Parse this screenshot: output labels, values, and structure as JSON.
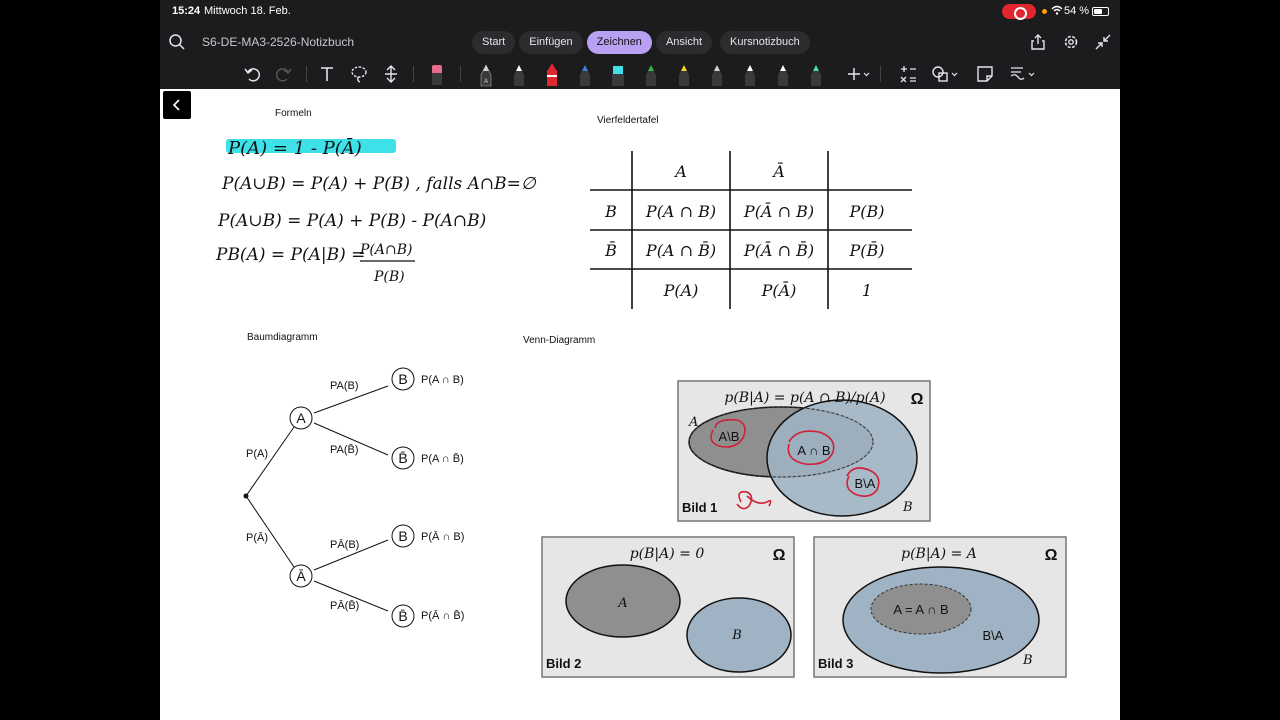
{
  "status": {
    "time": "15:24",
    "date": "Mittwoch 18. Feb.",
    "battery": "54 %"
  },
  "header": {
    "doc_title": "S6-DE-MA3-2526-Notizbuch",
    "tabs": [
      "Start",
      "Einfügen",
      "Zeichnen",
      "Ansicht",
      "Kursnotizbuch"
    ],
    "active_tab": "Zeichnen"
  },
  "toolbar": {
    "pen_colors": [
      "#d0d0d0",
      "#ffffff",
      "#e0262f",
      "#3d7be0",
      "#3ee1e8",
      "#2fb54a",
      "#f5d32a",
      "#cfcfcf",
      "#ffffff",
      "#ffffff",
      "#3fe09a"
    ],
    "highlighter_color": "#e86a8e",
    "accent": "#b8a1f2"
  },
  "notes": {
    "formeln_label": "Formeln",
    "formulas": [
      "P(A) = 1 - P(Ā)",
      "P(A∪B) = P(A) + P(B) , falls A∩B=∅",
      "P(A∪B) = P(A) + P(B) - P(A∩B)"
    ],
    "cond_lhs": "PB(A) = P(A|B) =",
    "cond_num": "P(A∩B)",
    "cond_den": "P(B)",
    "vierfelder_label": "Vierfeldertafel",
    "vierfelder": {
      "col_headers": [
        "A",
        "Ā"
      ],
      "rows": [
        {
          "head": "B",
          "cells": [
            "P(A ∩ B)",
            "P(Ā ∩ B)",
            "P(B)"
          ]
        },
        {
          "head": "B̄",
          "cells": [
            "P(A ∩ B̄)",
            "P(Ā ∩ B̄)",
            "P(B̄)"
          ]
        },
        {
          "head": "",
          "cells": [
            "P(A)",
            "P(Ā)",
            "1"
          ]
        }
      ]
    },
    "baum_label": "Baumdiagramm",
    "tree": {
      "node_a": "A",
      "node_a_bar": "Ā",
      "node_b": "B",
      "node_b_bar": "B̄",
      "edge_pa": "P(A)",
      "edge_pa_bar": "P(Ā)",
      "edge_pa_b": "PA(B)",
      "edge_pa_bbar": "PA(B̄)",
      "edge_pabar_b": "PĀ(B)",
      "edge_pabar_bbar": "PĀ(B̄)",
      "leaf_1": "P(A ∩ B)",
      "leaf_2": "P(A ∩ B̄)",
      "leaf_3": "P(Ā ∩ B)",
      "leaf_4": "P(Ā ∩ B̄)"
    },
    "venn_label": "Venn-Diagramm",
    "venn": {
      "bild1_title": "p(B|A) = p(A ∩ B)/p(A)",
      "bild1_caption": "Bild 1",
      "bild2_title": "p(B|A) = 0",
      "bild2_caption": "Bild 2",
      "bild3_title": "p(B|A) = A",
      "bild3_caption": "Bild 3",
      "omega": "Ω",
      "set_a": "A",
      "set_b": "B",
      "a_minus_b": "A\\B",
      "a_cap_b": "A ∩ B",
      "b_minus_a": "B\\A",
      "a_eq": "A = A ∩ B",
      "venn_bg": "#e6e6e6",
      "set_a_color": "#8f8f8f",
      "set_b_color": "#9fb3c4",
      "ink_red": "#d0203a"
    }
  }
}
